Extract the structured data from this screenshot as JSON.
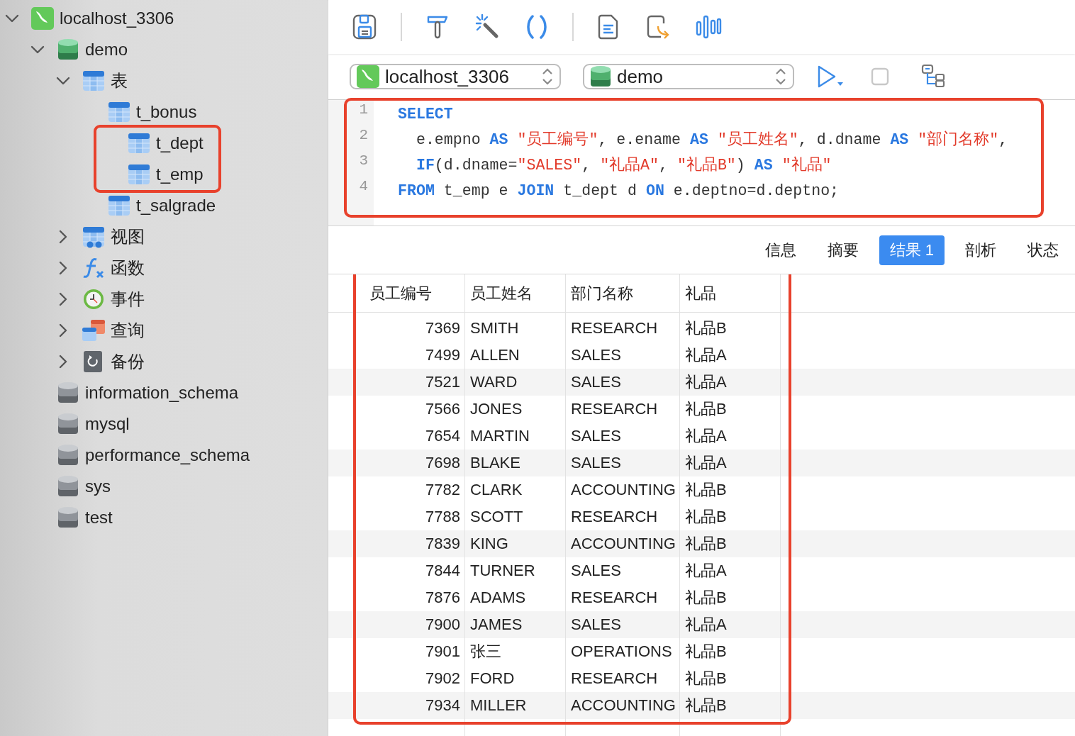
{
  "sidebar": {
    "tree": [
      {
        "label": "localhost_3306",
        "kind": "connection",
        "expanded": true,
        "children": [
          {
            "label": "demo",
            "kind": "database",
            "opened": true,
            "expanded": true,
            "children": [
              {
                "label": "表",
                "kind": "tables",
                "expanded": true,
                "children": [
                  {
                    "label": "t_bonus",
                    "kind": "table",
                    "highlighted": false
                  },
                  {
                    "label": "t_dept",
                    "kind": "table",
                    "highlighted": true
                  },
                  {
                    "label": "t_emp",
                    "kind": "table",
                    "highlighted": true
                  },
                  {
                    "label": "t_salgrade",
                    "kind": "table",
                    "highlighted": false
                  }
                ]
              },
              {
                "label": "视图",
                "kind": "views",
                "expanded": false
              },
              {
                "label": "函数",
                "kind": "functions",
                "expanded": false
              },
              {
                "label": "事件",
                "kind": "events",
                "expanded": false
              },
              {
                "label": "查询",
                "kind": "queries",
                "expanded": false
              },
              {
                "label": "备份",
                "kind": "backups",
                "expanded": false
              }
            ]
          },
          {
            "label": "information_schema",
            "kind": "database",
            "opened": false
          },
          {
            "label": "mysql",
            "kind": "database",
            "opened": false
          },
          {
            "label": "performance_schema",
            "kind": "database",
            "opened": false
          },
          {
            "label": "sys",
            "kind": "database",
            "opened": false
          },
          {
            "label": "test",
            "kind": "database",
            "opened": false
          }
        ]
      }
    ]
  },
  "toolbar": {
    "connection": "localhost_3306",
    "database": "demo"
  },
  "editor": {
    "highlighted": true,
    "lines": [
      {
        "number": "1",
        "tokens": [
          {
            "kind": "keyword",
            "text": "SELECT"
          }
        ]
      },
      {
        "number": "2",
        "tokens": [
          {
            "kind": "plain",
            "text": "  e.empno "
          },
          {
            "kind": "keyword",
            "text": "AS"
          },
          {
            "kind": "string",
            "text": " \"员工编号\""
          },
          {
            "kind": "plain",
            "text": ", e.ename "
          },
          {
            "kind": "keyword",
            "text": "AS"
          },
          {
            "kind": "string",
            "text": " \"员工姓名\""
          },
          {
            "kind": "plain",
            "text": ", d.dname "
          },
          {
            "kind": "keyword",
            "text": "AS"
          },
          {
            "kind": "string",
            "text": " \"部门名称\""
          },
          {
            "kind": "plain",
            "text": ","
          }
        ]
      },
      {
        "number": "3",
        "tokens": [
          {
            "kind": "keyword",
            "text": "  IF"
          },
          {
            "kind": "plain",
            "text": "(d.dname="
          },
          {
            "kind": "string",
            "text": "\"SALES\""
          },
          {
            "kind": "plain",
            "text": ", "
          },
          {
            "kind": "string",
            "text": "\"礼品A\""
          },
          {
            "kind": "plain",
            "text": ", "
          },
          {
            "kind": "string",
            "text": "\"礼品B\""
          },
          {
            "kind": "plain",
            "text": ") "
          },
          {
            "kind": "keyword",
            "text": "AS"
          },
          {
            "kind": "string",
            "text": " \"礼品\""
          }
        ]
      },
      {
        "number": "4",
        "tokens": [
          {
            "kind": "keyword",
            "text": "FROM"
          },
          {
            "kind": "plain",
            "text": " t_emp e "
          },
          {
            "kind": "keyword",
            "text": "JOIN"
          },
          {
            "kind": "plain",
            "text": " t_dept d "
          },
          {
            "kind": "keyword",
            "text": "ON"
          },
          {
            "kind": "plain",
            "text": " e.deptno=d.deptno;"
          }
        ]
      }
    ]
  },
  "result_tabs": [
    {
      "label": "信息",
      "selected": false
    },
    {
      "label": "摘要",
      "selected": false
    },
    {
      "label": "结果 1",
      "selected": true
    },
    {
      "label": "剖析",
      "selected": false
    },
    {
      "label": "状态",
      "selected": false
    }
  ],
  "results": {
    "highlighted": true,
    "columns": [
      {
        "label": "员工编号",
        "kind": "number"
      },
      {
        "label": "员工姓名",
        "kind": "text"
      },
      {
        "label": "部门名称",
        "kind": "text"
      },
      {
        "label": "礼品",
        "kind": "text"
      }
    ],
    "rows": [
      [
        "7369",
        "SMITH",
        "RESEARCH",
        "礼品B"
      ],
      [
        "7499",
        "ALLEN",
        "SALES",
        "礼品A"
      ],
      [
        "7521",
        "WARD",
        "SALES",
        "礼品A"
      ],
      [
        "7566",
        "JONES",
        "RESEARCH",
        "礼品B"
      ],
      [
        "7654",
        "MARTIN",
        "SALES",
        "礼品A"
      ],
      [
        "7698",
        "BLAKE",
        "SALES",
        "礼品A"
      ],
      [
        "7782",
        "CLARK",
        "ACCOUNTING",
        "礼品B"
      ],
      [
        "7788",
        "SCOTT",
        "RESEARCH",
        "礼品B"
      ],
      [
        "7839",
        "KING",
        "ACCOUNTING",
        "礼品B"
      ],
      [
        "7844",
        "TURNER",
        "SALES",
        "礼品A"
      ],
      [
        "7876",
        "ADAMS",
        "RESEARCH",
        "礼品B"
      ],
      [
        "7900",
        "JAMES",
        "SALES",
        "礼品A"
      ],
      [
        "7901",
        "张三",
        "OPERATIONS",
        "礼品B"
      ],
      [
        "7902",
        "FORD",
        "RESEARCH",
        "礼品B"
      ],
      [
        "7934",
        "MILLER",
        "ACCOUNTING",
        "礼品B"
      ]
    ]
  }
}
